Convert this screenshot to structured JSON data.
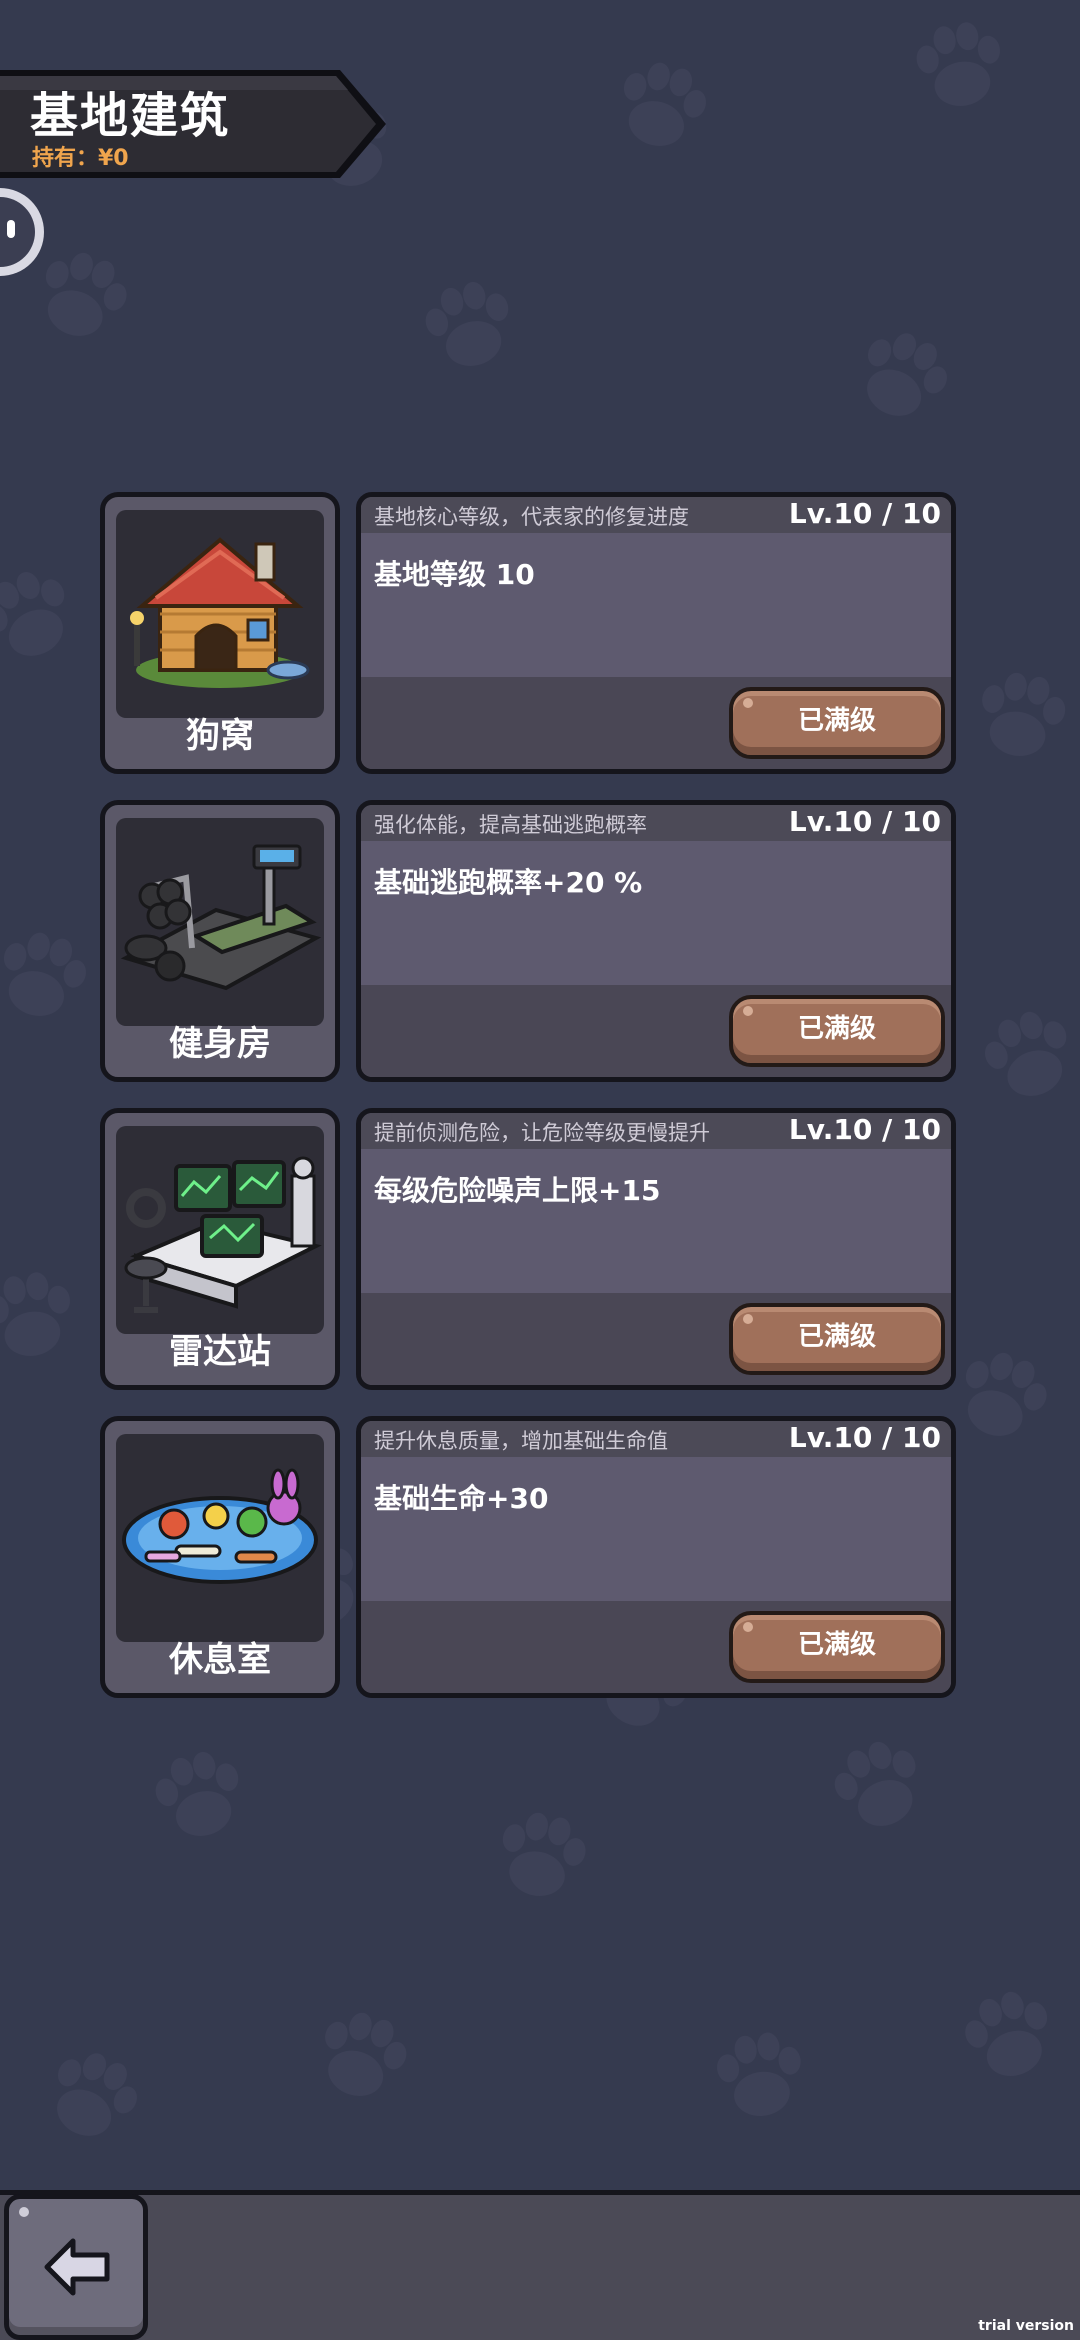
{
  "header": {
    "title": "基地建筑",
    "money": "持有：¥0"
  },
  "buildings": [
    {
      "name": "狗窝",
      "icon": "doghouse-icon",
      "desc": "基地核心等级，代表家的修复进度",
      "level": "Lv.10 / 10",
      "effect": "基地等级 10",
      "button": "已满级"
    },
    {
      "name": "健身房",
      "icon": "gym-icon",
      "desc": "强化体能，提高基础逃跑概率",
      "level": "Lv.10 / 10",
      "effect": "基础逃跑概率+20 %",
      "button": "已满级"
    },
    {
      "name": "雷达站",
      "icon": "radar-station-icon",
      "desc": "提前侦测危险，让危险等级更慢提升",
      "level": "Lv.10 / 10",
      "effect": "每级危险噪声上限+15",
      "button": "已满级"
    },
    {
      "name": "休息室",
      "icon": "rest-room-icon",
      "desc": "提升休息质量，增加基础生命值",
      "level": "Lv.10 / 10",
      "effect": "基础生命+30",
      "button": "已满级"
    }
  ],
  "footer": {
    "back_icon": "back-arrow-icon",
    "watermark": "trial version"
  },
  "colors": {
    "background": "#353a4f",
    "button": "#a0705a",
    "money": "#f0a54d"
  }
}
